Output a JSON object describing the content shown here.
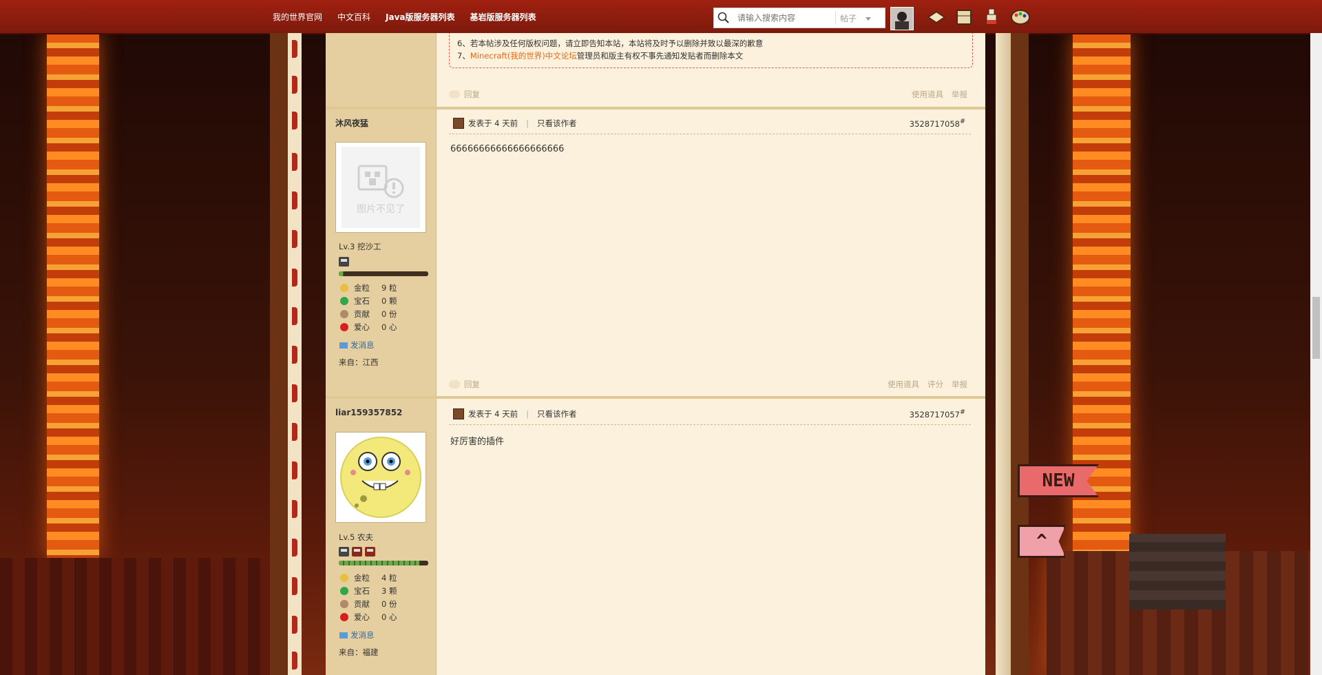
{
  "nav": {
    "links": [
      "我的世界官网",
      "中文百科",
      "Java版服务器列表",
      "基岩版服务器列表"
    ]
  },
  "search": {
    "placeholder": "请输入搜索内容",
    "scope": "帖子"
  },
  "rules": {
    "line6": "6、若本帖涉及任何版权问题，请立即告知本站，本站将及时予以删除并致以最深的歉意",
    "line7_prefix": "7、",
    "line7_link": "Minecraft(我的世界)中文论坛",
    "line7_suffix": "管理员和版主有权不事先通知发贴者而删除本文"
  },
  "actions": {
    "reply": "回复",
    "use_tool": "使用道具",
    "rate": "评分",
    "report": "举报"
  },
  "posts": [
    {
      "username": "沐风夜猛",
      "avatar_text": "图片不见了",
      "level": "Lv.3 挖沙工",
      "xp_fraction": 0.05,
      "stats": [
        {
          "label": "金粒",
          "value": "9 粒"
        },
        {
          "label": "宝石",
          "value": "0 颗"
        },
        {
          "label": "贡献",
          "value": "0 份"
        },
        {
          "label": "爱心",
          "value": "0 心"
        }
      ],
      "send_message": "发消息",
      "from": "来自：江西",
      "posted": "发表于 4 天前",
      "only_author": "只看该作者",
      "post_number": "3528717058",
      "content": "66666666666666666666"
    },
    {
      "username": "liar159357852",
      "level": "Lv.5 农夫",
      "xp_fraction": 0.9,
      "stats": [
        {
          "label": "金粒",
          "value": "4 粒"
        },
        {
          "label": "宝石",
          "value": "3 颗"
        },
        {
          "label": "贡献",
          "value": "0 份"
        },
        {
          "label": "爱心",
          "value": "0 心"
        }
      ],
      "send_message": "发消息",
      "from": "来自：福建",
      "posted": "发表于 4 天前",
      "only_author": "只看该作者",
      "post_number": "3528717057",
      "content": "好厉害的插件"
    }
  ],
  "side_flags": {
    "new": "NEW",
    "up": "^"
  },
  "colors": {
    "topbar": "#8c1c0c",
    "link_orange": "#e76a17",
    "panel": "#fbf1dc",
    "sidebar": "#e5cfa1"
  }
}
